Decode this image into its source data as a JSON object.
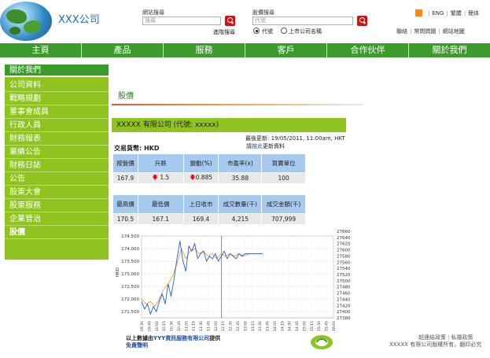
{
  "header": {
    "company_name": "XXX公司",
    "web_search": {
      "label": "網站搜尋",
      "placeholder": "搜尋",
      "advanced": "進階搜尋"
    },
    "stock_search": {
      "label": "股價搜尋",
      "placeholder": "代號",
      "options": [
        "代號",
        "上市公司名稱"
      ],
      "selected": "代號"
    },
    "lang_links": [
      "ENG",
      "繁體",
      "簡体"
    ],
    "util_links": [
      "聯絡",
      "常問問題",
      "網站地圖"
    ]
  },
  "nav": {
    "items": [
      "主頁",
      "產品",
      "服務",
      "客戶",
      "合作伙伴",
      "關於我們"
    ]
  },
  "sidebar": {
    "title": "關於我們",
    "items": [
      "公司資料",
      "戰略規劃",
      "董事會成員",
      "行政人員",
      "財務報表",
      "業績公告",
      "財務日誌",
      "公告",
      "股東大會",
      "股東服務",
      "企業管治",
      "股價"
    ],
    "active": "股價"
  },
  "main": {
    "title": "股價",
    "stock_name": "XXXXX 有限公司 (代號: xxxxx)",
    "last_update": "最後更新: 19/05/2011, 11:00am, HKT",
    "refresh_prefix": "請",
    "refresh_link": "按此",
    "refresh_suffix": "更新資料",
    "currency": "交易貨幣: HKD",
    "table1": {
      "headers": [
        "按盤價",
        "升跌",
        "變動(%)",
        "市盈率(x)",
        "買賣單位"
      ],
      "values": [
        "167.9",
        "1.5",
        "0.885",
        "35.88",
        "100"
      ]
    },
    "table2": {
      "headers": [
        "最高價",
        "最低價",
        "上日收市",
        "成交數量(千)",
        "成交金額(千)"
      ],
      "values": [
        "170.5",
        "167.1",
        "169.4",
        "4,215",
        "707,999"
      ]
    }
  },
  "chart_data": {
    "type": "line",
    "ylabel": "HKD",
    "left_axis": {
      "ylim": [
        171.25,
        174.5
      ],
      "ticks": [
        "174.500",
        "174.000",
        "173.500",
        "173.000",
        "172.500",
        "172.000",
        "171.500"
      ]
    },
    "right_axis": {
      "ticks": [
        "27660",
        "27640",
        "27620",
        "27600",
        "27580",
        "27560",
        "27540",
        "27520",
        "27500",
        "27480",
        "27460",
        "27440",
        "27420",
        "27400",
        "27380"
      ]
    },
    "x_ticks": [
      "09:30",
      "09:45",
      "10:00",
      "10:15",
      "10:30",
      "10:45",
      "11:00",
      "11:15",
      "11:30",
      "11:45",
      "12:00",
      "12:15",
      "12:30",
      "12:45",
      "13:00",
      "13:15",
      "13:30",
      "13:45",
      "14:00",
      "14:15",
      "14:30",
      "14:45",
      "15:00",
      "15:15",
      "15:30",
      "15:45",
      "16:00"
    ],
    "series": [
      {
        "color": "#2a5cc9",
        "x": [
          0,
          0.4,
          0.8,
          1.2,
          1.6,
          2.0,
          2.4,
          2.8,
          3.2,
          3.6,
          4.0,
          4.4,
          4.8,
          5.2,
          5.6,
          6.0,
          6.4,
          6.8,
          7.2,
          7.6,
          8.0,
          8.4,
          8.8,
          9.2,
          9.6,
          10.0,
          10.4,
          10.8,
          11.2,
          11.6,
          12.0,
          12.4,
          12.8,
          13.2,
          13.6,
          14.0,
          14.6,
          15.6,
          16.4
        ],
        "y": [
          171.9,
          171.6,
          171.8,
          171.4,
          171.7,
          171.5,
          171.9,
          172.2,
          171.8,
          172.6,
          172.1,
          172.8,
          173.6,
          174.3,
          173.5,
          173.1,
          174.1,
          173.9,
          174.2,
          173.6,
          173.8,
          173.9,
          173.5,
          173.7,
          173.6,
          173.8,
          173.5,
          173.7,
          173.9,
          173.6,
          173.8,
          173.7,
          173.6,
          173.8,
          173.7,
          173.8,
          173.8,
          173.8,
          173.8
        ]
      },
      {
        "color": "#d9a43c",
        "x": [
          0,
          0.6,
          1.2,
          1.8,
          2.4,
          3.0,
          3.6,
          4.2,
          4.8,
          5.4,
          6.0,
          6.6,
          7.2,
          7.8,
          8.4,
          9.0,
          9.6,
          10.2,
          10.8,
          11.4,
          12.0,
          12.6,
          13.2,
          13.8,
          14.6,
          15.6,
          16.4
        ],
        "y": [
          172.0,
          171.8,
          171.9,
          171.7,
          172.0,
          172.4,
          172.6,
          172.9,
          173.4,
          174.0,
          173.6,
          173.9,
          174.0,
          173.8,
          173.9,
          173.7,
          173.8,
          173.6,
          173.8,
          173.7,
          173.8,
          173.7,
          173.8,
          173.7,
          173.8,
          173.8,
          173.8
        ]
      }
    ]
  },
  "footer": {
    "note_prefix": "以上數據由",
    "note_provider": "YYY資訊服務有限公司",
    "note_suffix": "提供",
    "disclaimer": "免責聲明",
    "links": [
      "超連結政策",
      "私隱政策"
    ],
    "copyright": "XXXXX 有限公司版權所有，翻印必究"
  }
}
